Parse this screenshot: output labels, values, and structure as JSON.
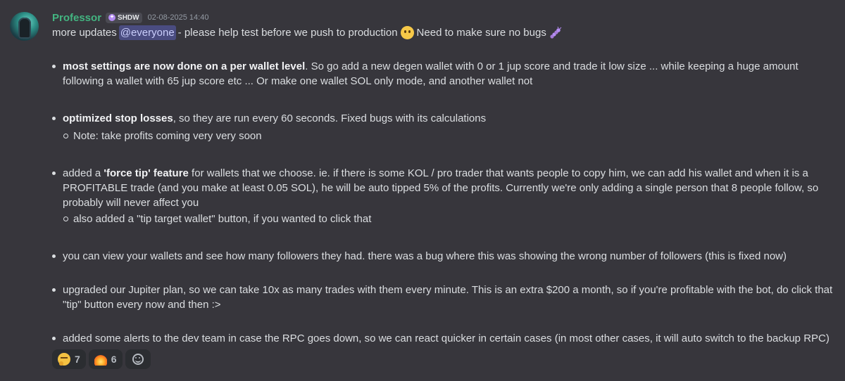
{
  "message": {
    "author": "Professor",
    "tag": {
      "label": "SHDW"
    },
    "timestamp": "02-08-2025 14:40",
    "intro": {
      "before": "more updates",
      "mention": "@everyone",
      "middle": " - please help test before we push to production",
      "after": "Need to make sure no bugs"
    },
    "bullets": [
      {
        "bold": "most settings are now done on a per wallet level",
        "text": ". So go add a new degen wallet with 0 or 1 jup score and trade it low size ... while keeping a huge amount following a wallet with 65 jup score etc ... Or make one wallet SOL only mode, and another wallet not"
      },
      {
        "bold": "optimized stop losses",
        "text": ", so they are run every 60 seconds. Fixed bugs with its calculations",
        "sub": [
          "Note: take profits coming very very soon"
        ]
      },
      {
        "prefix": "added a ",
        "bold": "'force tip' feature",
        "text": " for wallets that we choose. ie. if there is some KOL / pro trader that wants people to copy him, we can add his wallet and when it is a PROFITABLE trade (and you make at least 0.05 SOL), he will be auto tipped 5% of the profits. Currently we're only adding a single person that 8 people follow, so probably will never affect you",
        "sub": [
          "also added a \"tip target wallet\" button, if you wanted to click that"
        ]
      },
      {
        "text": "you can view your wallets and see how many followers they had. there was a bug where this was showing the wrong number of followers (this is fixed now)"
      },
      {
        "text": "upgraded our Jupiter plan, so we can take 10x as many trades with them every minute. This is an extra $200 a month, so if you're profitable with the bot, do click that \"tip\" button every now and then :>"
      },
      {
        "text": "added some alerts to the dev team in case the RPC goes down, so we can react quicker in certain cases (in most other cases, it will auto switch to the backup RPC)"
      }
    ],
    "reactions": [
      {
        "icon": "thinking-face-icon",
        "count": "7"
      },
      {
        "icon": "fire-icon",
        "count": "6"
      }
    ]
  },
  "colors": {
    "background": "#37363c",
    "username": "#43b581",
    "mention_bg": "#4a4c80"
  }
}
